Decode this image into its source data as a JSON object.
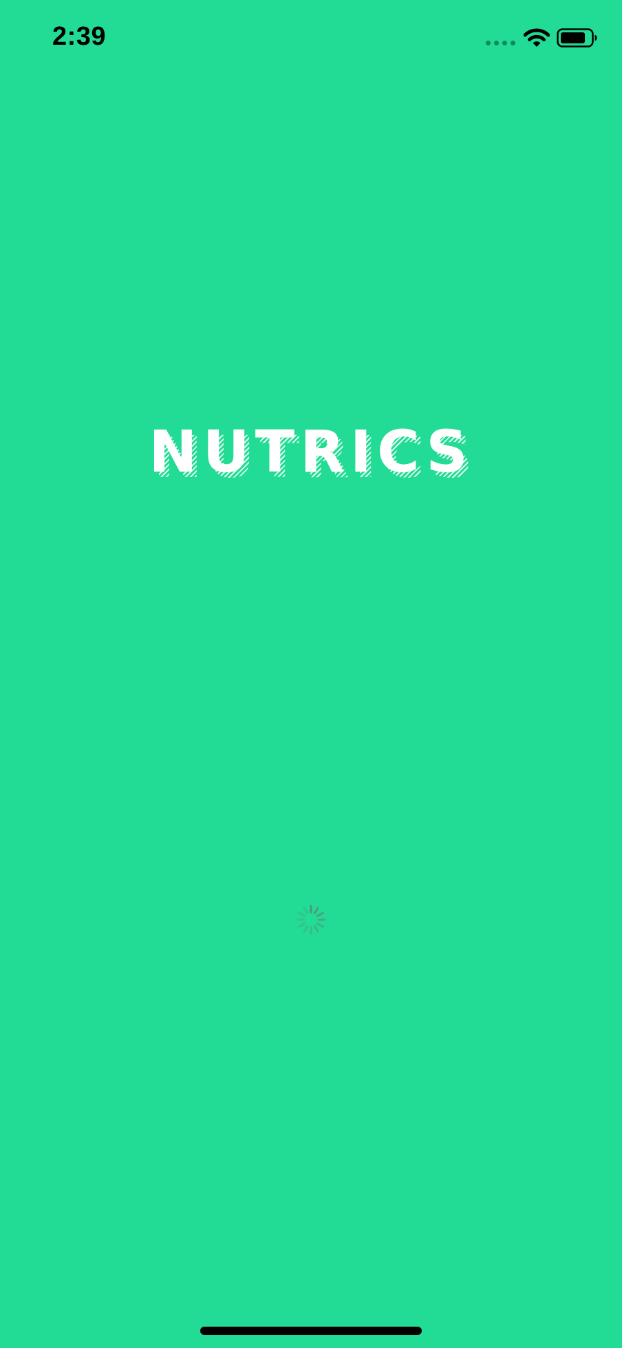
{
  "status_bar": {
    "time": "2:39",
    "icons": [
      "cellular-signal-icon",
      "wifi-icon",
      "battery-icon"
    ]
  },
  "splash": {
    "logo_text": "NUTRICS",
    "loading_indicator": "spinner-icon"
  },
  "colors": {
    "background": "#22db94",
    "logo": "#ffffff",
    "status_text": "#000000"
  }
}
